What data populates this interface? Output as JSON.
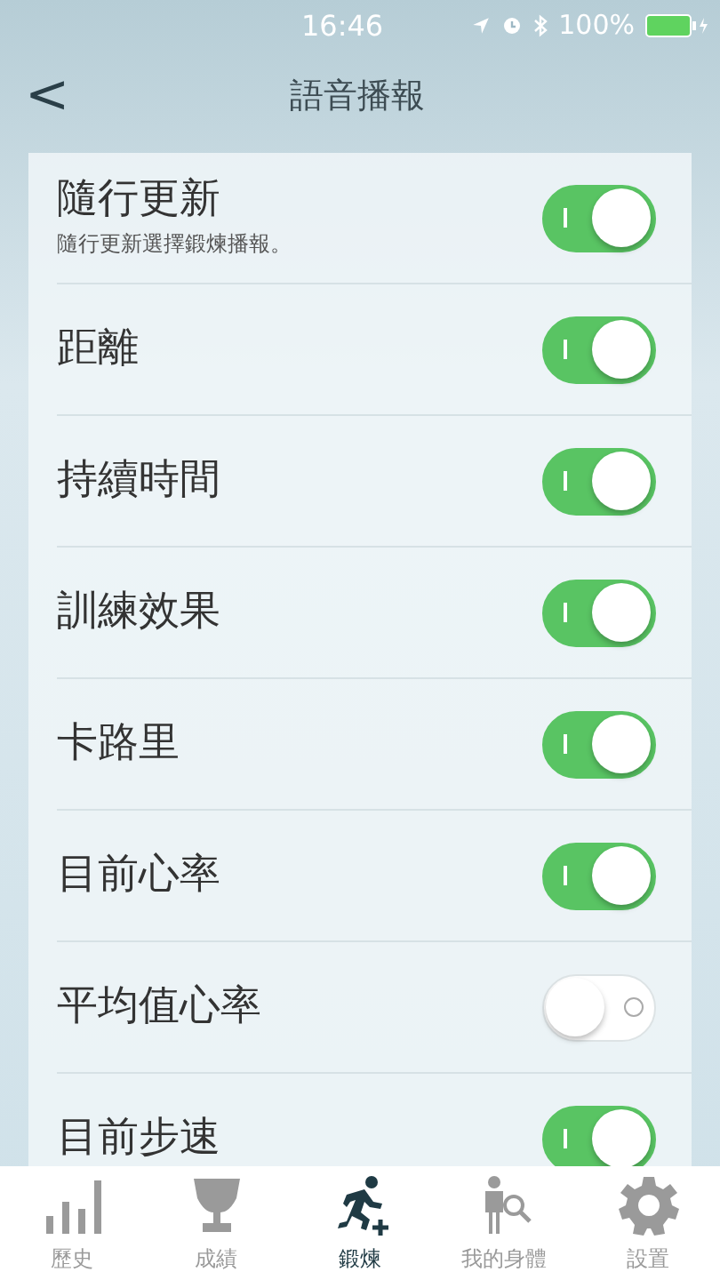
{
  "status_bar": {
    "time": "16:46",
    "battery": "100%"
  },
  "nav": {
    "back": "<",
    "title": "語音播報"
  },
  "settings": [
    {
      "label": "隨行更新",
      "subtitle": "隨行更新選擇鍛煉播報。",
      "on": true
    },
    {
      "label": "距離",
      "on": true
    },
    {
      "label": "持續時間",
      "on": true
    },
    {
      "label": "訓練效果",
      "on": true
    },
    {
      "label": "卡路里",
      "on": true
    },
    {
      "label": "目前心率",
      "on": true
    },
    {
      "label": "平均值心率",
      "on": false
    },
    {
      "label": "目前步速",
      "on": true
    }
  ],
  "tab_bar": [
    {
      "label": "歷史",
      "kind": "bars",
      "selected": false
    },
    {
      "label": "成績",
      "kind": "trophy",
      "selected": false
    },
    {
      "label": "鍛煉",
      "kind": "runner",
      "selected": true
    },
    {
      "label": "我的身體",
      "kind": "body",
      "selected": false
    },
    {
      "label": "設置",
      "kind": "gear",
      "selected": false
    }
  ]
}
